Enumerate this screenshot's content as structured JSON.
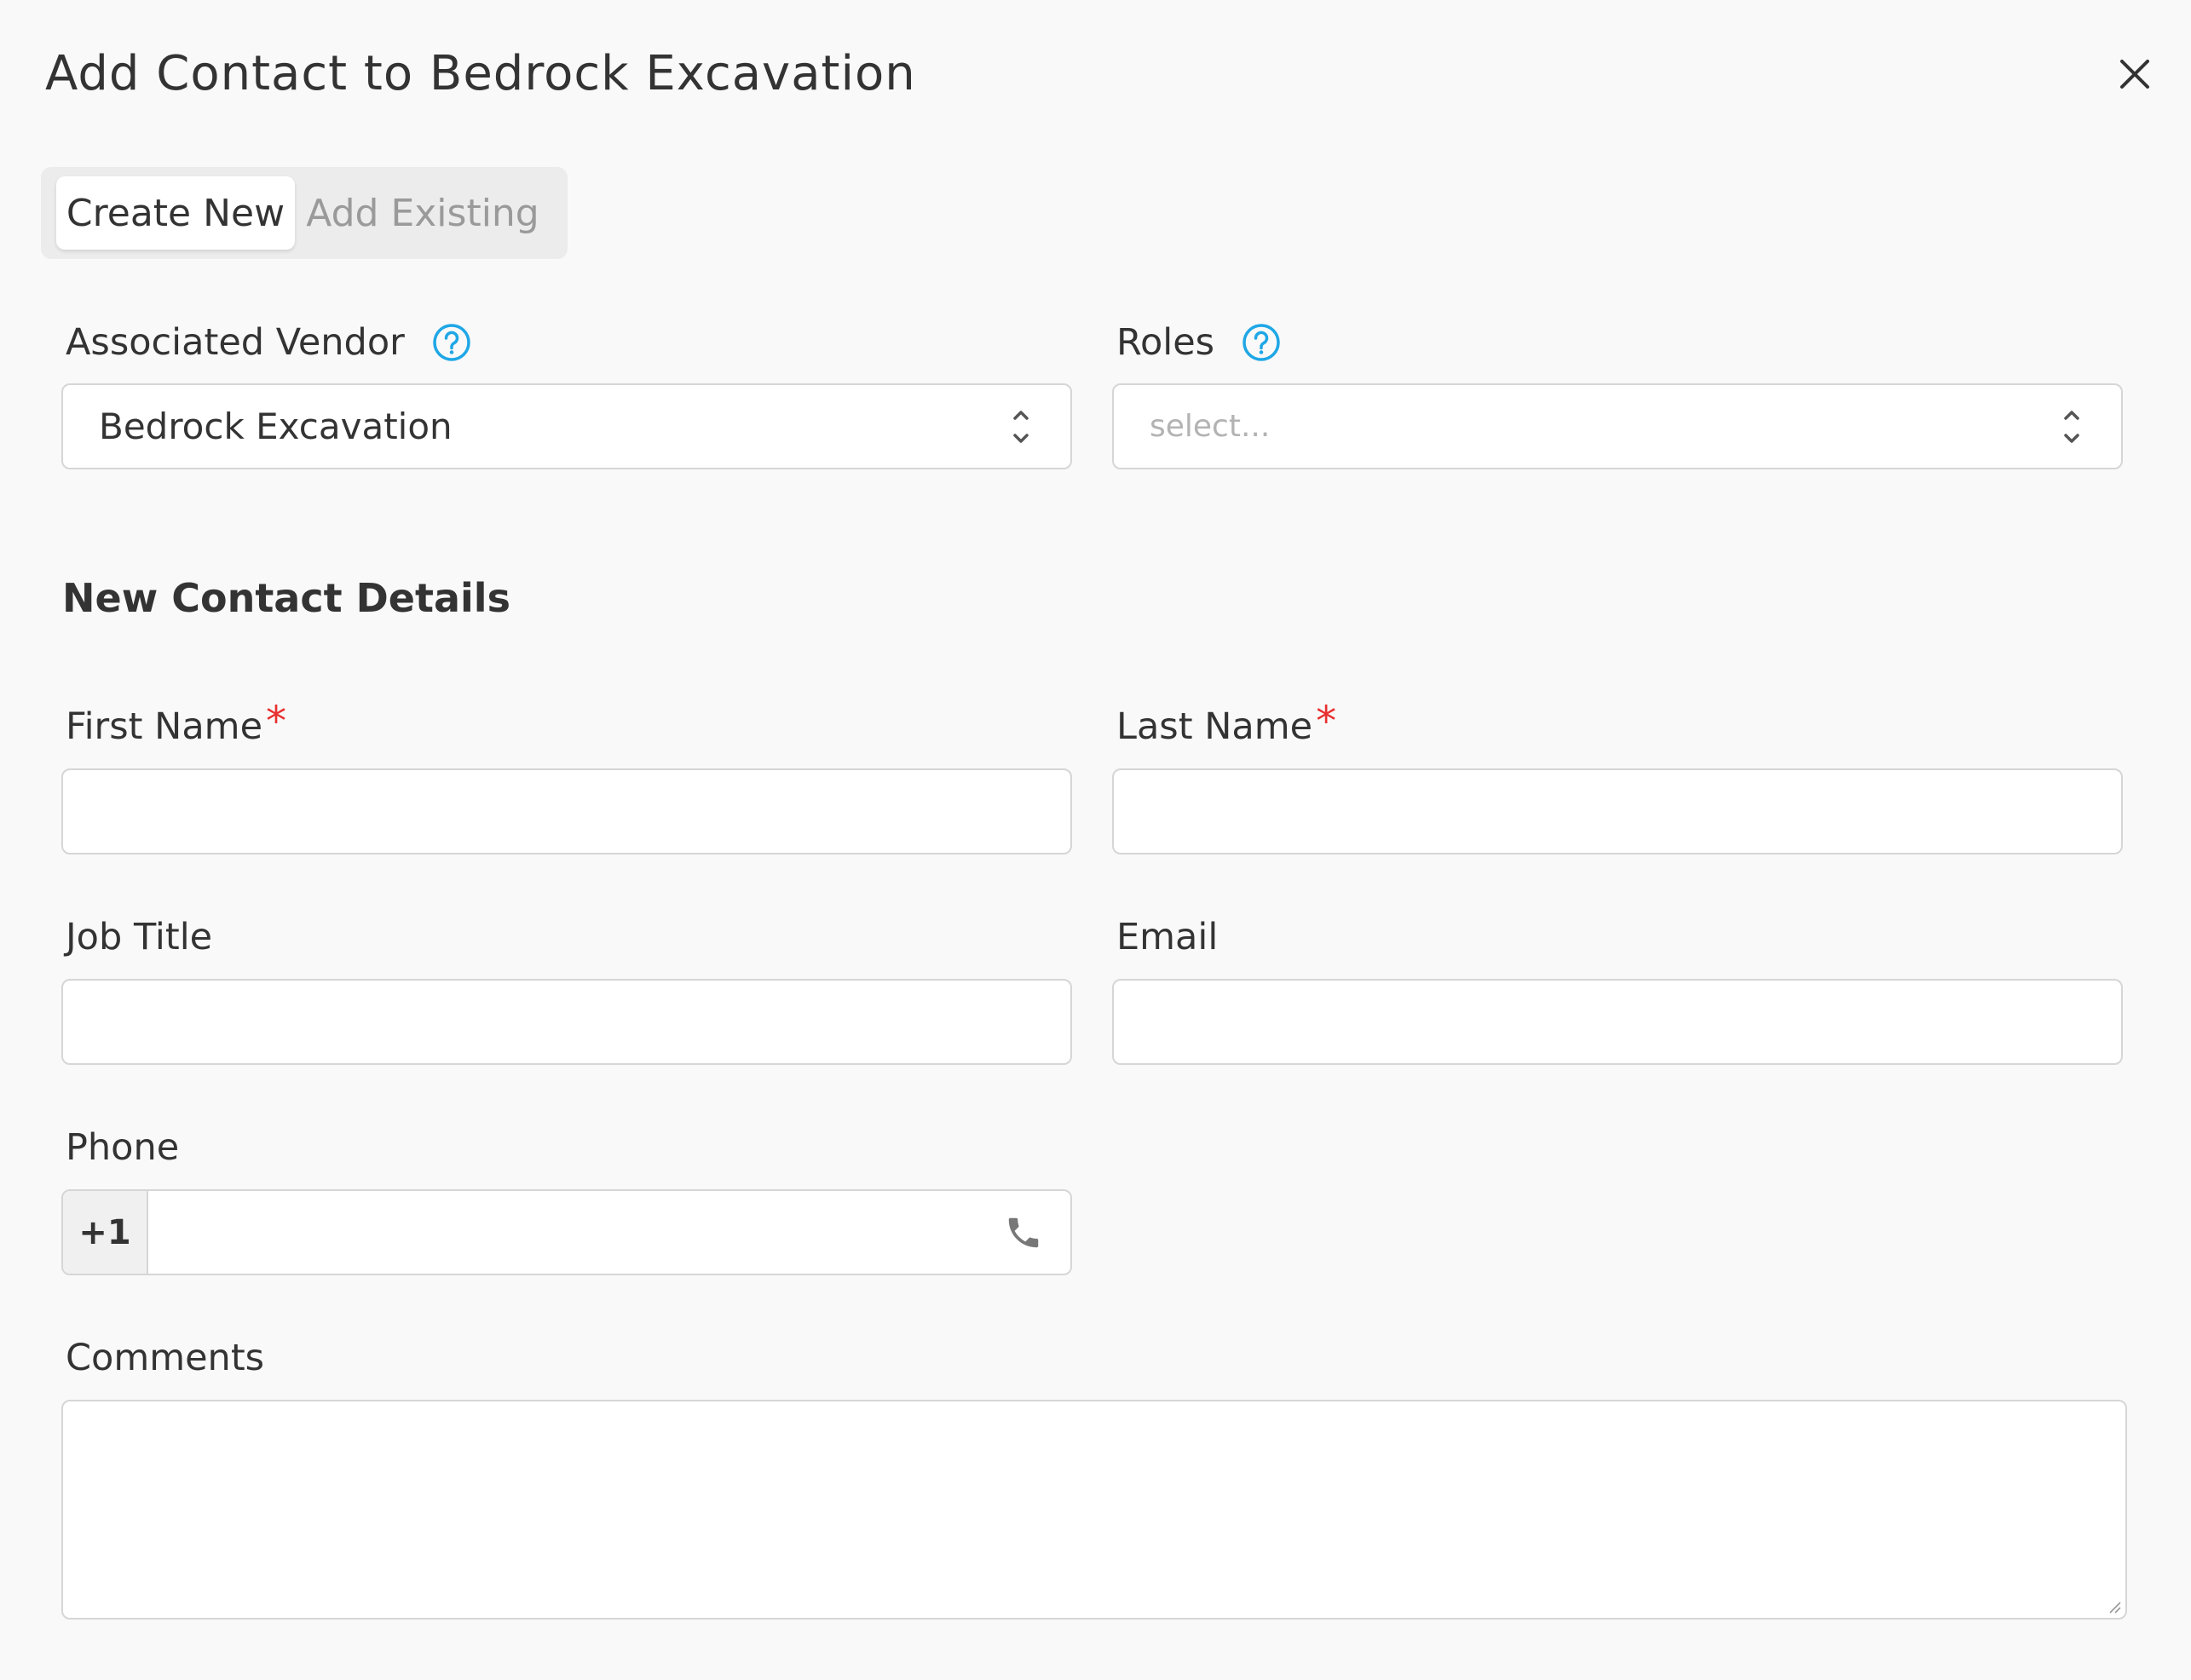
{
  "modal": {
    "title": "Add Contact to Bedrock Excavation"
  },
  "tabs": [
    {
      "label": "Create New",
      "active": true
    },
    {
      "label": "Add Existing",
      "active": false
    }
  ],
  "vendor": {
    "label": "Associated Vendor",
    "value": "Bedrock Excavation"
  },
  "roles": {
    "label": "Roles",
    "placeholder": "select..."
  },
  "section_title": "New Contact Details",
  "fields": {
    "first_name": {
      "label": "First Name",
      "required_mark": "*",
      "value": ""
    },
    "last_name": {
      "label": "Last Name",
      "required_mark": "*",
      "value": ""
    },
    "job_title": {
      "label": "Job Title",
      "value": ""
    },
    "email": {
      "label": "Email",
      "value": ""
    },
    "phone": {
      "label": "Phone",
      "country_code": "+1",
      "value": ""
    },
    "comments": {
      "label": "Comments",
      "value": ""
    }
  },
  "colors": {
    "accent": "#1fa7e6",
    "required": "#e8302f",
    "border": "#d6d6d6",
    "background": "#f9f9f9"
  },
  "icons": {
    "close": "close-icon",
    "help": "help-circle-icon",
    "select": "chevron-up-down-icon",
    "phone": "phone-icon"
  }
}
